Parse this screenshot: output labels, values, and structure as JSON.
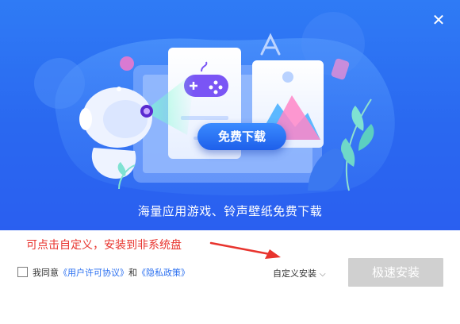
{
  "header": {
    "close_glyph": "✕",
    "cta_label": "免费下载",
    "tagline": "海量应用游戏、铃声壁纸免费下载"
  },
  "annotation": {
    "hint": "可点击自定义，安装到非系统盘",
    "color": "#e8342e"
  },
  "footer": {
    "agree_prefix": "我同意",
    "license_link": "《用户许可协议》",
    "and_text": "和",
    "privacy_link": "《隐私政策》",
    "custom_install_label": "自定义安装",
    "install_button_label": "极速安装",
    "install_button_enabled": false
  },
  "colors": {
    "banner_blue": "#2a68f0",
    "link_blue": "#2a6ff0",
    "disabled_gray": "#d0d0d0"
  }
}
